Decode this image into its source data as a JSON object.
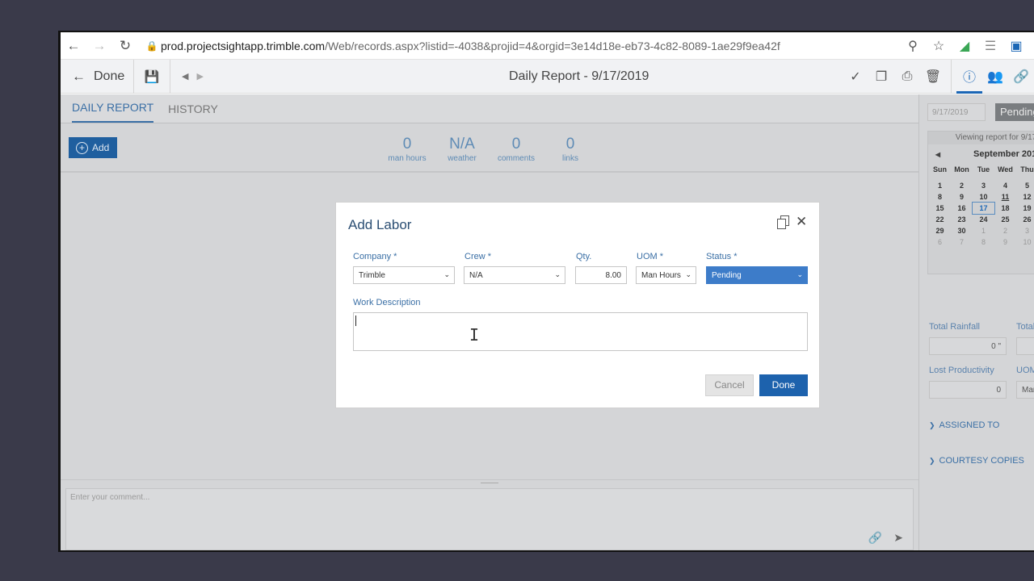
{
  "browser": {
    "url_host": "prod.projectsightapp.trimble.com",
    "url_path": "/Web/records.aspx?listid=-4038&projid=4&orgid=3e14d18e-eb73-4c82-8089-1ae29f9ea42f"
  },
  "toolbar": {
    "done_label": "Done",
    "title": "Daily Report - 9/17/2019"
  },
  "tabs": [
    {
      "label": "DAILY REPORT"
    },
    {
      "label": "HISTORY"
    }
  ],
  "summary": {
    "add_label": "Add",
    "stats": [
      {
        "value": "0",
        "label": "man hours"
      },
      {
        "value": "N/A",
        "label": "weather"
      },
      {
        "value": "0",
        "label": "comments"
      },
      {
        "value": "0",
        "label": "links"
      }
    ]
  },
  "comment": {
    "placeholder": "Enter your comment..."
  },
  "right_panel": {
    "date": "9/17/2019",
    "status": "Pending",
    "viewing": "Viewing report for 9/17",
    "month": "September 201",
    "day_names": [
      "Sun",
      "Mon",
      "Tue",
      "Wed",
      "Thu"
    ],
    "weeks": [
      [
        "1",
        "2",
        "3",
        "4",
        "5"
      ],
      [
        "8",
        "9",
        "10",
        "11",
        "12"
      ],
      [
        "15",
        "16",
        "17",
        "18",
        "19"
      ],
      [
        "22",
        "23",
        "24",
        "25",
        "26"
      ],
      [
        "29",
        "30",
        "1",
        "2",
        "3"
      ],
      [
        "6",
        "7",
        "8",
        "9",
        "10"
      ]
    ],
    "total_rainfall_label": "Total Rainfall",
    "total_rainfall_value": "0 \"",
    "total_label": "Total",
    "lost_productivity_label": "Lost Productivity",
    "lost_productivity_value": "0",
    "uom_label": "UOM",
    "uom_value": "Mar",
    "assigned_to": "ASSIGNED TO",
    "courtesy_copies": "COURTESY COPIES"
  },
  "modal": {
    "title": "Add Labor",
    "company_label": "Company *",
    "company_value": "Trimble",
    "crew_label": "Crew *",
    "crew_value": "N/A",
    "qty_label": "Qty.",
    "qty_value": "8.00",
    "uom_label": "UOM *",
    "uom_value": "Man Hours",
    "status_label": "Status *",
    "status_value": "Pending",
    "work_description_label": "Work Description",
    "work_description_value": "",
    "cancel_label": "Cancel",
    "done_label": "Done"
  }
}
